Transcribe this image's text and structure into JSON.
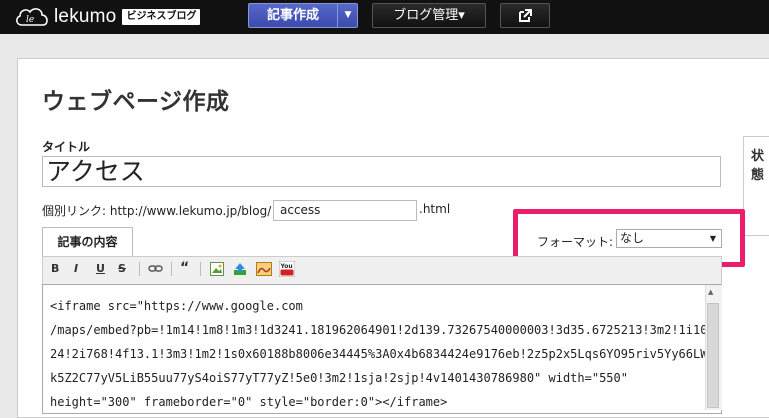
{
  "header": {
    "logo_text": "lekumo",
    "logo_badge": "ビジネスブログ",
    "create_button": "記事作成",
    "blog_manage_button": "ブログ管理▾"
  },
  "page": {
    "title": "ウェブページ作成"
  },
  "form": {
    "title_label": "タイトル",
    "title_value": "アクセス",
    "link_label": "個別リンク: http://www.lekumo.jp/blog/",
    "link_value": "access",
    "link_suffix": ".html",
    "tab_label": "記事の内容",
    "format_label": "フォーマット:",
    "format_value": "なし",
    "side_label": "状態"
  },
  "toolbar": {
    "bold": "B",
    "italic": "I",
    "underline": "U",
    "strike": "S",
    "quote": "“",
    "youtube": "You"
  },
  "editor": {
    "lines": [
      "<iframe src=\"https://www.google.com",
      "/maps/embed?pb=!1m14!1m8!1m3!1d3241.181962064901!2d139.73267540000003!3d35.6725213!3m2!1i10",
      "24!2i768!4f13.1!3m3!1m2!1s0x60188b8006e34445%3A0x4b6834424e9176eb!2z5p2x5Lqs6YO95riv5Yy66LW",
      "k5Z2C77yV5LiB55uu77yS4oiS77yT77yZ!5e0!3m2!1sja!2sjp!4v1401430786980\" width=\"550\"",
      "height=\"300\" frameborder=\"0\" style=\"border:0\"></iframe>"
    ]
  },
  "colors": {
    "header_bg": "#111111",
    "create_button_bg": "#4a5abd",
    "highlight_border": "#ec1e6b"
  }
}
